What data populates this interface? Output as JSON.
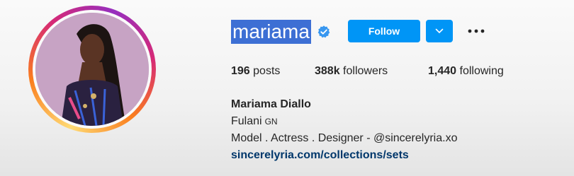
{
  "profile": {
    "username": "mariama",
    "follow_label": "Follow",
    "stats": {
      "posts_count": "196",
      "posts_label": "posts",
      "followers_count": "388k",
      "followers_label": "followers",
      "following_count": "1,440",
      "following_label": "following"
    },
    "bio": {
      "full_name": "Mariama Diallo",
      "line1": "Fulani",
      "pronouns": "GN",
      "line2": "Model . Actress . Designer - @sincerelyria.xo",
      "website": "sincerelyria.com/collections/sets"
    }
  },
  "icons": {
    "verified": "verified-badge-icon",
    "dropdown": "chevron-down-icon",
    "more": "more-options-icon"
  },
  "colors": {
    "accent": "#0095f6",
    "link": "#00376b",
    "selection": "#3d6fd4"
  }
}
